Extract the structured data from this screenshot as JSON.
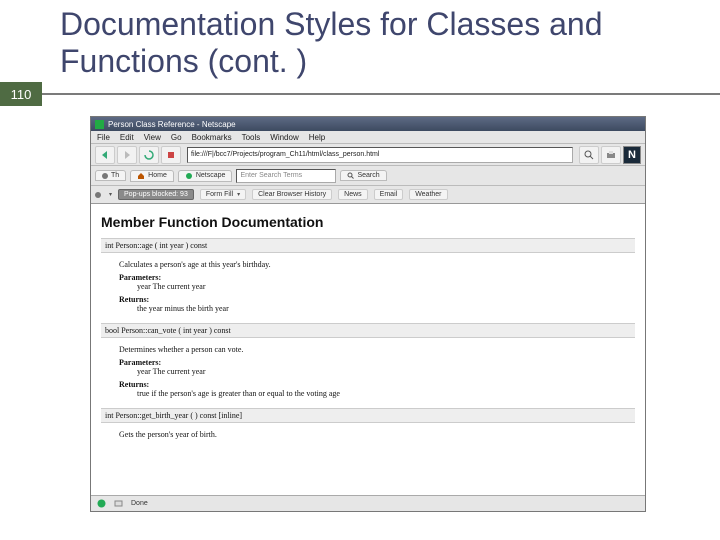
{
  "slide": {
    "title": "Documentation Styles for Classes and Functions (cont. )",
    "number": "110"
  },
  "browser": {
    "window_title": "Person Class Reference - Netscape",
    "menus": [
      "File",
      "Edit",
      "View",
      "Go",
      "Bookmarks",
      "Tools",
      "Window",
      "Help"
    ],
    "url": "file:///F|/bcc7/Projects/program_Ch11/html/class_person.html",
    "n_badge": "N",
    "tabs": {
      "th": "Th",
      "home": "Home",
      "netscape": "Netscape"
    },
    "search_placeholder": "Enter Search Terms",
    "search_btn": "Search",
    "tb3": {
      "popups": "Pop-ups blocked: 93",
      "formfill": "Form Fill",
      "clear": "Clear Browser History",
      "news": "News",
      "email": "Email",
      "weather": "Weather"
    },
    "status": {
      "done": "Done"
    }
  },
  "doc": {
    "heading": "Member Function Documentation",
    "f1": {
      "sig": "int Person::age ( int year ) const",
      "desc": "Calculates a person's age at this year's birthday.",
      "params_label": "Parameters:",
      "param1": "year The current year",
      "returns_label": "Returns:",
      "returns": "the year minus the birth year"
    },
    "f2": {
      "sig": "bool Person::can_vote ( int year ) const",
      "desc": "Determines whether a person can vote.",
      "params_label": "Parameters:",
      "param1": "year The current year",
      "returns_label": "Returns:",
      "returns": "true if the person's age is greater than or equal to the voting age"
    },
    "f3": {
      "sig": "int Person::get_birth_year ( ) const  [inline]",
      "desc": "Gets the person's year of birth."
    }
  }
}
